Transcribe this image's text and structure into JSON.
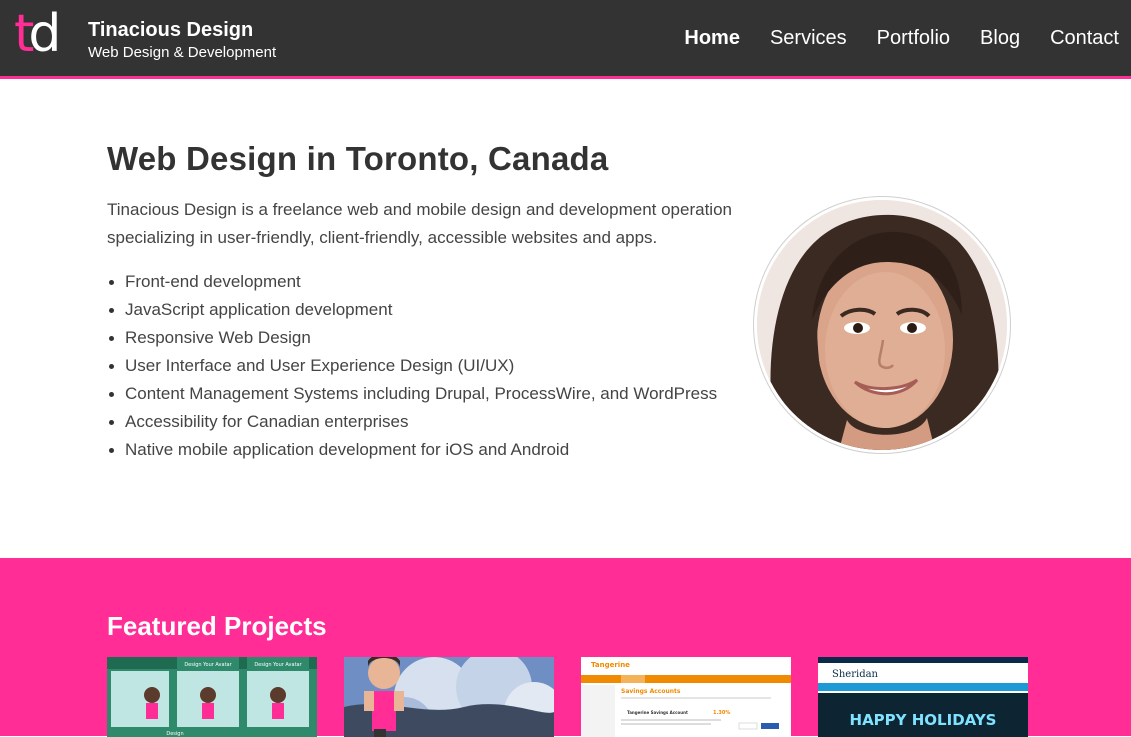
{
  "header": {
    "logo_t": "t",
    "logo_d": "d",
    "brand_name": "Tinacious Design",
    "brand_tagline": "Web Design & Development",
    "nav": [
      "Home",
      "Services",
      "Portfolio",
      "Blog",
      "Contact"
    ],
    "active_nav": "Home"
  },
  "intro": {
    "title": "Web Design in Toronto, Canada",
    "description": "Tinacious Design is a freelance web and mobile design and development operation specializing in user-friendly, client-friendly, accessible websites and apps.",
    "services": [
      "Front-end development",
      "JavaScript application development",
      "Responsive Web Design",
      "User Interface and User Experience Design (UI/UX)",
      "Content Management Systems including Drupal, ProcessWire, and WordPress",
      "Accessibility for Canadian enterprises",
      "Native mobile application development for iOS and Android"
    ]
  },
  "featured": {
    "title": "Featured Projects",
    "thumbs": {
      "app": {
        "header_text": "Design Your Avatar",
        "tab_label": "Design"
      },
      "tangerine": {
        "brand": "Tangerine",
        "heading": "Savings Accounts",
        "sub_heading": "Tangerine Savings Account",
        "rate": "1.30%"
      },
      "sheridan": {
        "brand": "Sheridan",
        "banner": "HAPPY HOLIDAYS"
      }
    }
  },
  "colors": {
    "accent": "#ff2d95",
    "header_bg": "#333333",
    "text": "#333333"
  }
}
